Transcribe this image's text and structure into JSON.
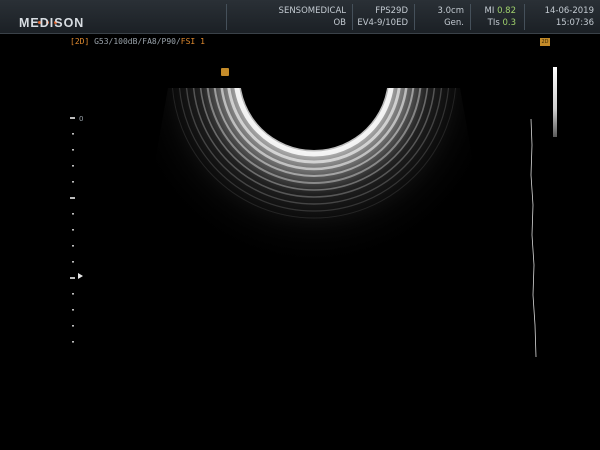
{
  "header": {
    "brand": "MEDISON",
    "institution": "SENSOMEDICAL",
    "preset": "OB",
    "fps": "FPS29D",
    "probe": "EV4-9/10ED",
    "depth": "3.0cm",
    "freq_mode": "Gen.",
    "mi_label": "MI",
    "mi_value": "0.82",
    "tis_label": "TIs",
    "tis_value": "0.3",
    "date": "14-06-2019",
    "time": "15:07:36"
  },
  "imaging": {
    "mode_tag": "[2D]",
    "params": "G53/100dB/FA8/P90/",
    "fsi": "FSI 1",
    "depth_scale_top": "0",
    "corner_badge": "2D"
  },
  "colors": {
    "accent_orange": "#e08a2f",
    "marker_gold": "#c48b29",
    "value_green": "#9fd16c"
  }
}
